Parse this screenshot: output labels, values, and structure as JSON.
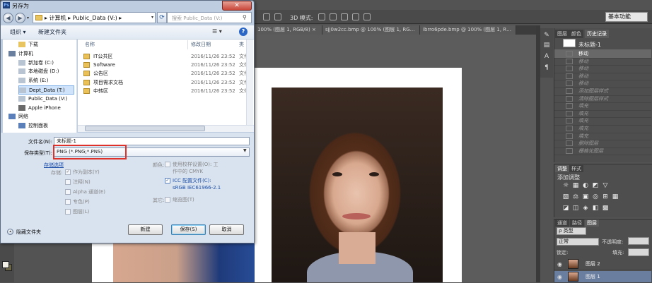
{
  "ps": {
    "options_label": "3D 模式:",
    "workspace": "基本功能",
    "doc_tabs": [
      "100% (图层 1, RGB/8) ×",
      "sjj0w2cc.bmp @ 100% (图层 1, RGB/8) ×",
      "ibrro6pde.bmp @ 100% (图层 1, RGB/8) ×"
    ],
    "history": {
      "tabs": [
        "图层",
        "颜色",
        "历史记录"
      ],
      "snapshot": "未标题-1",
      "rows": [
        "移动",
        "移动",
        "移动",
        "移动",
        "移动",
        "添加图层样式",
        "清除图层样式",
        "填充",
        "填充",
        "填充",
        "填充",
        "填充",
        "删除图层",
        "栅格化图层"
      ]
    },
    "adjust": {
      "tabs": [
        "调整",
        "样式"
      ],
      "title": "添加调整",
      "icons_row1": [
        "☼",
        "▦",
        "◐",
        "◩",
        "▽"
      ],
      "icons_row2": [
        "▧",
        "⚖",
        "▣",
        "◎",
        "⊞",
        "▦"
      ],
      "icons_row3": [
        "◪",
        "◫",
        "◈",
        "◧",
        "▩"
      ]
    },
    "layers": {
      "tabs": [
        "通道",
        "路径",
        "图层"
      ],
      "kind_select": "ρ 类型",
      "blend_select": "正常",
      "opacity_label": "不透明度:",
      "lock_label": "锁定:",
      "fill_label": "填充:",
      "rows": [
        "图层 2",
        "图层 1"
      ]
    }
  },
  "dialog": {
    "title": "另存为",
    "title_icon": "Ps",
    "close_glyph": "✕",
    "nav": {
      "back": "◀",
      "forward": "▶",
      "dropdown": "▾",
      "refresh": "⟳"
    },
    "breadcrumb": "▸ 计算机 ▸ Public_Data (V:) ▸",
    "search_placeholder": "搜索 Public_Data (V:)",
    "toolbar": {
      "organize": "组织 ▾",
      "new_folder": "新建文件夹",
      "view": "☰ ▾",
      "help": "?"
    },
    "nav_tree": [
      {
        "label": "下载",
        "icon": "#e8c560"
      },
      {
        "label": "计算机",
        "icon": "#6a7f9e",
        "header": true
      },
      {
        "label": "新加卷 (C:)",
        "icon": "#b9c4d2"
      },
      {
        "label": "本地磁盘 (D:)",
        "icon": "#b9c4d2"
      },
      {
        "label": "系统 (E:)",
        "icon": "#b9c4d2"
      },
      {
        "label": "Dept_Data (T:)",
        "icon": "#b9c4d2",
        "selected": true
      },
      {
        "label": "Public_Data (V:)",
        "icon": "#b9c4d2"
      },
      {
        "label": "Apple iPhone",
        "icon": "#6a6a6a"
      },
      {
        "label": "网络",
        "icon": "#5b7fb9",
        "header": true
      },
      {
        "label": "控制面板",
        "icon": "#5b7fb9"
      }
    ],
    "columns": {
      "name": "名称",
      "date": "修改日期",
      "type": "类"
    },
    "files": [
      {
        "name": "IT公共区",
        "date": "2016/11/26 23:52",
        "type": "文件"
      },
      {
        "name": "Software",
        "date": "2016/11/26 23:52",
        "type": "文件"
      },
      {
        "name": "公告区",
        "date": "2016/11/26 23:52",
        "type": "文件"
      },
      {
        "name": "项目需求文档",
        "date": "2016/11/26 23:52",
        "type": "文件"
      },
      {
        "name": "中转区",
        "date": "2016/11/26 23:52",
        "type": "文件"
      }
    ],
    "filename_label": "文件名(N):",
    "filename_value": "未标题-1",
    "filetype_label": "保存类型(T):",
    "filetype_value": "PNG (*.PNG;*.PNS)",
    "store_options": "存储选项",
    "store_label": "存储:",
    "store_checks": [
      {
        "label": "作为副本(Y)",
        "checked": true
      },
      {
        "label": "注释(N)",
        "checked": false
      },
      {
        "label": "Alpha 通道(E)",
        "checked": false
      },
      {
        "label": "专色(P)",
        "checked": false
      },
      {
        "label": "图层(L)",
        "checked": false
      }
    ],
    "color_label": "颜色:",
    "proof_check": "使用校样设置(O): 工",
    "proof_sub": "作中的 CMYK",
    "icc_check": "ICC 配置文件(C):",
    "icc_sub": "sRGB IEC61966-2.1",
    "other_label": "其它:",
    "thumb_check": "缩览图(T)",
    "hide_folders": "隐藏文件夹",
    "hide_folders_glyph": "▴",
    "buttons": {
      "new": "新建",
      "save": "保存(S)",
      "cancel": "取消"
    }
  }
}
